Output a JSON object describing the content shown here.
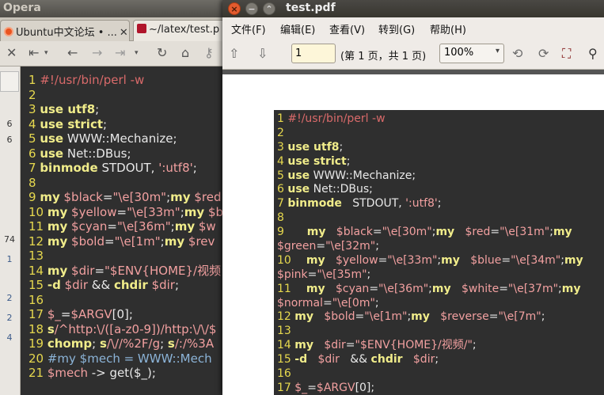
{
  "opera": {
    "title": "Opera",
    "tabs": [
      {
        "label": "Ubuntu中文论坛 • ...",
        "close": "✕"
      },
      {
        "label": "~/latex/test.p"
      }
    ],
    "side_numbers": [
      "6",
      "6",
      "74",
      "1",
      "2",
      "2",
      "4"
    ],
    "code_lines": [
      [
        {
          "t": "1 ",
          "c": "ln"
        },
        {
          "t": "#!/usr/bin/perl -w",
          "c": "cm"
        }
      ],
      [
        {
          "t": "2",
          "c": "ln"
        }
      ],
      [
        {
          "t": "3 ",
          "c": "ln"
        },
        {
          "t": "use utf8",
          "c": "kw"
        },
        {
          "t": ";",
          "c": "txt"
        }
      ],
      [
        {
          "t": "4 ",
          "c": "ln"
        },
        {
          "t": "use strict",
          "c": "kw"
        },
        {
          "t": ";",
          "c": "txt"
        }
      ],
      [
        {
          "t": "5 ",
          "c": "ln"
        },
        {
          "t": "use",
          "c": "kw"
        },
        {
          "t": " WWW::Mechanize;",
          "c": "txt"
        }
      ],
      [
        {
          "t": "6 ",
          "c": "ln"
        },
        {
          "t": "use",
          "c": "kw"
        },
        {
          "t": " Net::DBus;",
          "c": "txt"
        }
      ],
      [
        {
          "t": "7 ",
          "c": "ln"
        },
        {
          "t": "binmode",
          "c": "kw"
        },
        {
          "t": " STDOUT, ",
          "c": "txt"
        },
        {
          "t": "':utf8'",
          "c": "str"
        },
        {
          "t": ";",
          "c": "txt"
        }
      ],
      [
        {
          "t": "8",
          "c": "ln"
        }
      ],
      [
        {
          "t": "9 ",
          "c": "ln"
        },
        {
          "t": "my",
          "c": "kw"
        },
        {
          "t": " $black",
          "c": "var"
        },
        {
          "t": "=",
          "c": "txt"
        },
        {
          "t": "\"\\e[30m\"",
          "c": "str"
        },
        {
          "t": ";",
          "c": "txt"
        },
        {
          "t": "my",
          "c": "kw"
        },
        {
          "t": " $red",
          "c": "var"
        }
      ],
      [
        {
          "t": "10 ",
          "c": "ln"
        },
        {
          "t": "my",
          "c": "kw"
        },
        {
          "t": " $yellow",
          "c": "var"
        },
        {
          "t": "=",
          "c": "txt"
        },
        {
          "t": "\"\\e[33m\"",
          "c": "str"
        },
        {
          "t": ";",
          "c": "txt"
        },
        {
          "t": "my",
          "c": "kw"
        },
        {
          "t": " $b",
          "c": "var"
        }
      ],
      [
        {
          "t": "11 ",
          "c": "ln"
        },
        {
          "t": "my",
          "c": "kw"
        },
        {
          "t": " $cyan",
          "c": "var"
        },
        {
          "t": "=",
          "c": "txt"
        },
        {
          "t": "\"\\e[36m\"",
          "c": "str"
        },
        {
          "t": ";",
          "c": "txt"
        },
        {
          "t": "my",
          "c": "kw"
        },
        {
          "t": " $w",
          "c": "var"
        }
      ],
      [
        {
          "t": "12 ",
          "c": "ln"
        },
        {
          "t": "my",
          "c": "kw"
        },
        {
          "t": " $bold",
          "c": "var"
        },
        {
          "t": "=",
          "c": "txt"
        },
        {
          "t": "\"\\e[1m\"",
          "c": "str"
        },
        {
          "t": ";",
          "c": "txt"
        },
        {
          "t": "my",
          "c": "kw"
        },
        {
          "t": " $rev",
          "c": "var"
        }
      ],
      [
        {
          "t": "13",
          "c": "ln"
        }
      ],
      [
        {
          "t": "14 ",
          "c": "ln"
        },
        {
          "t": "my",
          "c": "kw"
        },
        {
          "t": " $dir",
          "c": "var"
        },
        {
          "t": "=",
          "c": "txt"
        },
        {
          "t": "\"$ENV{HOME}/视频",
          "c": "str"
        }
      ],
      [
        {
          "t": "15 ",
          "c": "ln"
        },
        {
          "t": "-d",
          "c": "kw"
        },
        {
          "t": " $dir",
          "c": "var"
        },
        {
          "t": " && ",
          "c": "txt"
        },
        {
          "t": "chdir",
          "c": "kw"
        },
        {
          "t": " $dir",
          "c": "var"
        },
        {
          "t": ";",
          "c": "txt"
        }
      ],
      [
        {
          "t": "16",
          "c": "ln"
        }
      ],
      [
        {
          "t": "17 ",
          "c": "ln"
        },
        {
          "t": "$_",
          "c": "var"
        },
        {
          "t": "=",
          "c": "txt"
        },
        {
          "t": "$ARGV",
          "c": "var"
        },
        {
          "t": "[0];",
          "c": "txt"
        }
      ],
      [
        {
          "t": "18 ",
          "c": "ln"
        },
        {
          "t": "s",
          "c": "kw"
        },
        {
          "t": "/^http:\\/([a-z0-9])/http:\\/\\/$",
          "c": "str"
        }
      ],
      [
        {
          "t": "19 ",
          "c": "ln"
        },
        {
          "t": "chomp",
          "c": "kw"
        },
        {
          "t": "; ",
          "c": "txt"
        },
        {
          "t": "s",
          "c": "kw"
        },
        {
          "t": "/\\//%2F/g",
          "c": "str"
        },
        {
          "t": "; ",
          "c": "txt"
        },
        {
          "t": "s",
          "c": "kw"
        },
        {
          "t": "/:/%3A",
          "c": "str"
        }
      ],
      [
        {
          "t": "20 ",
          "c": "ln"
        },
        {
          "t": "#my $mech = WWW::Mech",
          "c": "cmt"
        }
      ],
      [
        {
          "t": "21 ",
          "c": "ln"
        },
        {
          "t": "$mech",
          "c": "var"
        },
        {
          "t": " -> get($_);",
          "c": "txt"
        }
      ]
    ]
  },
  "evince": {
    "title": "test.pdf",
    "window_buttons": {
      "close": "×",
      "minimize": "−",
      "maximize": "⌃"
    },
    "menu": [
      "文件(F)",
      "编辑(E)",
      "查看(V)",
      "转到(G)",
      "帮助(H)"
    ],
    "page_input": "1",
    "page_info": "(第 1 页，共 1 页)",
    "zoom": "100%",
    "code_lines": [
      [
        {
          "t": "1 ",
          "c": "ln"
        },
        {
          "t": "#!/usr/bin/perl -w",
          "c": "cm"
        }
      ],
      [
        {
          "t": "2",
          "c": "ln"
        }
      ],
      [
        {
          "t": "3 ",
          "c": "ln"
        },
        {
          "t": "use utf8",
          "c": "kw"
        },
        {
          "t": ";",
          "c": "txt"
        }
      ],
      [
        {
          "t": "4 ",
          "c": "ln"
        },
        {
          "t": "use strict",
          "c": "kw"
        },
        {
          "t": ";",
          "c": "txt"
        }
      ],
      [
        {
          "t": "5 ",
          "c": "ln"
        },
        {
          "t": "use",
          "c": "kw"
        },
        {
          "t": " WWW::Mechanize;",
          "c": "txt"
        }
      ],
      [
        {
          "t": "6 ",
          "c": "ln"
        },
        {
          "t": "use",
          "c": "kw"
        },
        {
          "t": " Net::DBus;",
          "c": "txt"
        }
      ],
      [
        {
          "t": "7 ",
          "c": "ln"
        },
        {
          "t": "binmode",
          "c": "kw"
        },
        {
          "t": "   STDOUT, ",
          "c": "txt"
        },
        {
          "t": "':utf8'",
          "c": "str"
        },
        {
          "t": ";",
          "c": "txt"
        }
      ],
      [
        {
          "t": "8",
          "c": "ln"
        }
      ],
      [
        {
          "t": "9 ",
          "c": "ln"
        },
        {
          "t": "     my",
          "c": "kw"
        },
        {
          "t": "   $black",
          "c": "var"
        },
        {
          "t": "=",
          "c": "txt"
        },
        {
          "t": "\"\\e[30m\"",
          "c": "str"
        },
        {
          "t": ";",
          "c": "txt"
        },
        {
          "t": "my",
          "c": "kw"
        },
        {
          "t": "   $red",
          "c": "var"
        },
        {
          "t": "=",
          "c": "txt"
        },
        {
          "t": "\"\\e[31m\"",
          "c": "str"
        },
        {
          "t": ";",
          "c": "txt"
        },
        {
          "t": "my",
          "c": "kw"
        }
      ],
      [
        {
          "t": "$green",
          "c": "var"
        },
        {
          "t": "=",
          "c": "txt"
        },
        {
          "t": "\"\\e[32m\"",
          "c": "str"
        },
        {
          "t": ";",
          "c": "txt"
        }
      ],
      [
        {
          "t": "10 ",
          "c": "ln"
        },
        {
          "t": "   my",
          "c": "kw"
        },
        {
          "t": "   $yellow",
          "c": "var"
        },
        {
          "t": "=",
          "c": "txt"
        },
        {
          "t": "\"\\e[33m\"",
          "c": "str"
        },
        {
          "t": ";",
          "c": "txt"
        },
        {
          "t": "my",
          "c": "kw"
        },
        {
          "t": "   $blue",
          "c": "var"
        },
        {
          "t": "=",
          "c": "txt"
        },
        {
          "t": "\"\\e[34m\"",
          "c": "str"
        },
        {
          "t": ";",
          "c": "txt"
        },
        {
          "t": "my",
          "c": "kw"
        }
      ],
      [
        {
          "t": "$pink",
          "c": "var"
        },
        {
          "t": "=",
          "c": "txt"
        },
        {
          "t": "\"\\e[35m\"",
          "c": "str"
        },
        {
          "t": ";",
          "c": "txt"
        }
      ],
      [
        {
          "t": "11 ",
          "c": "ln"
        },
        {
          "t": "   my",
          "c": "kw"
        },
        {
          "t": "   $cyan",
          "c": "var"
        },
        {
          "t": "=",
          "c": "txt"
        },
        {
          "t": "\"\\e[36m\"",
          "c": "str"
        },
        {
          "t": ";",
          "c": "txt"
        },
        {
          "t": "my",
          "c": "kw"
        },
        {
          "t": "   $white",
          "c": "var"
        },
        {
          "t": "=",
          "c": "txt"
        },
        {
          "t": "\"\\e[37m\"",
          "c": "str"
        },
        {
          "t": ";",
          "c": "txt"
        },
        {
          "t": "my",
          "c": "kw"
        }
      ],
      [
        {
          "t": "$normal",
          "c": "var"
        },
        {
          "t": "=",
          "c": "txt"
        },
        {
          "t": "\"\\e[0m\"",
          "c": "str"
        },
        {
          "t": ";",
          "c": "txt"
        }
      ],
      [
        {
          "t": "12 ",
          "c": "ln"
        },
        {
          "t": "my",
          "c": "kw"
        },
        {
          "t": "   $bold",
          "c": "var"
        },
        {
          "t": "=",
          "c": "txt"
        },
        {
          "t": "\"\\e[1m\"",
          "c": "str"
        },
        {
          "t": ";",
          "c": "txt"
        },
        {
          "t": "my",
          "c": "kw"
        },
        {
          "t": "   $reverse",
          "c": "var"
        },
        {
          "t": "=",
          "c": "txt"
        },
        {
          "t": "\"\\e[7m\"",
          "c": "str"
        },
        {
          "t": ";",
          "c": "txt"
        }
      ],
      [
        {
          "t": "13",
          "c": "ln"
        }
      ],
      [
        {
          "t": "14 ",
          "c": "ln"
        },
        {
          "t": "my",
          "c": "kw"
        },
        {
          "t": "   $dir",
          "c": "var"
        },
        {
          "t": "=",
          "c": "txt"
        },
        {
          "t": "\"$ENV{HOME}/视频/\"",
          "c": "str"
        },
        {
          "t": ";",
          "c": "txt"
        }
      ],
      [
        {
          "t": "15 ",
          "c": "ln"
        },
        {
          "t": "-d",
          "c": "kw"
        },
        {
          "t": "   $dir",
          "c": "var"
        },
        {
          "t": "   && ",
          "c": "txt"
        },
        {
          "t": "chdir",
          "c": "kw"
        },
        {
          "t": "   $dir",
          "c": "var"
        },
        {
          "t": ";",
          "c": "txt"
        }
      ],
      [
        {
          "t": "16",
          "c": "ln"
        }
      ],
      [
        {
          "t": "17 ",
          "c": "ln"
        },
        {
          "t": "$_",
          "c": "var"
        },
        {
          "t": "=",
          "c": "txt"
        },
        {
          "t": "$ARGV",
          "c": "var"
        },
        {
          "t": "[0];",
          "c": "txt"
        }
      ]
    ]
  }
}
